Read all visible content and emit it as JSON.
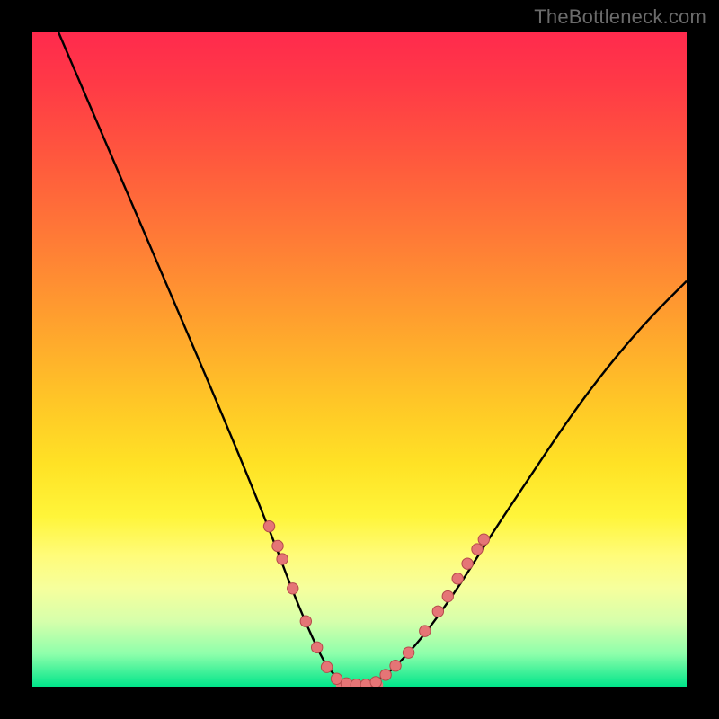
{
  "watermark": "TheBottleneck.com",
  "colors": {
    "gradient_top": "#ff2a4d",
    "gradient_mid": "#ffe225",
    "gradient_bottom": "#00e58a",
    "curve": "#000000",
    "dot_fill": "#e57576",
    "dot_stroke": "#b54a4b",
    "frame": "#000000"
  },
  "chart_data": {
    "type": "line",
    "title": "",
    "xlabel": "",
    "ylabel": "",
    "xlim": [
      0,
      100
    ],
    "ylim": [
      0,
      100
    ],
    "curve_points": [
      [
        4,
        100
      ],
      [
        10,
        86
      ],
      [
        16,
        72
      ],
      [
        22,
        58
      ],
      [
        28,
        44
      ],
      [
        33,
        32
      ],
      [
        37,
        22
      ],
      [
        40,
        14
      ],
      [
        43,
        7
      ],
      [
        45,
        3
      ],
      [
        47,
        1
      ],
      [
        49,
        0.2
      ],
      [
        51,
        0.2
      ],
      [
        53,
        1
      ],
      [
        56,
        3.5
      ],
      [
        60,
        8
      ],
      [
        65,
        15
      ],
      [
        70,
        23
      ],
      [
        76,
        32
      ],
      [
        82,
        41
      ],
      [
        88,
        49
      ],
      [
        94,
        56
      ],
      [
        100,
        62
      ]
    ],
    "flat_segment": {
      "x_start": 47,
      "x_end": 53,
      "y": 0.3
    },
    "dots": [
      [
        36.2,
        24.5
      ],
      [
        37.5,
        21.5
      ],
      [
        38.2,
        19.5
      ],
      [
        39.8,
        15.0
      ],
      [
        41.8,
        10.0
      ],
      [
        43.5,
        6.0
      ],
      [
        45.0,
        3.0
      ],
      [
        46.5,
        1.2
      ],
      [
        48.0,
        0.5
      ],
      [
        49.5,
        0.3
      ],
      [
        51.0,
        0.3
      ],
      [
        52.5,
        0.7
      ],
      [
        54.0,
        1.8
      ],
      [
        55.5,
        3.2
      ],
      [
        57.5,
        5.2
      ],
      [
        60.0,
        8.5
      ],
      [
        62.0,
        11.5
      ],
      [
        63.5,
        13.8
      ],
      [
        65.0,
        16.5
      ],
      [
        66.5,
        18.8
      ],
      [
        68.0,
        21.0
      ],
      [
        69.0,
        22.5
      ]
    ]
  }
}
